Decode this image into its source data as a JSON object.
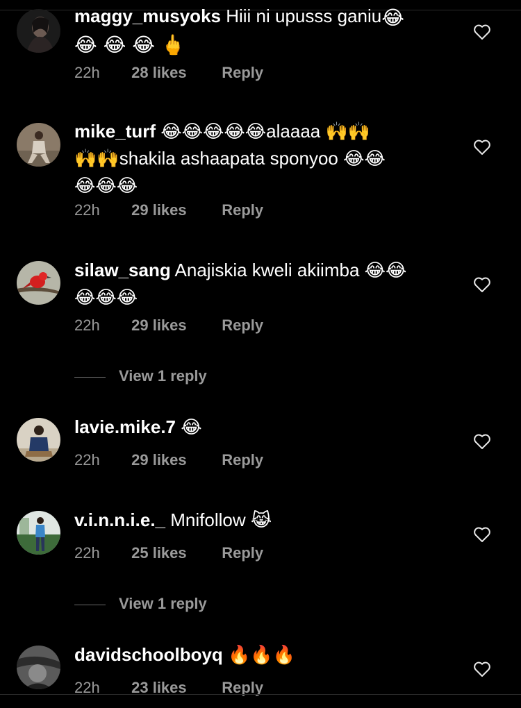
{
  "comments": [
    {
      "username": "maggy_musyoks",
      "text": "Hiii ni upusss ganiu",
      "emojis": "😂 😂 😂 🖕",
      "time": "22h",
      "likes": "28 likes",
      "reply_label": "Reply",
      "avatar_icon": "user-photo-avatar"
    },
    {
      "username": "mike_turf",
      "text_a": "😂😂😂😂😂alaaaa 🙌🙌",
      "text_b": "🙌🙌shakila ashaapata sponyoo 😂😂",
      "text_c": "😂😂😂",
      "time": "22h",
      "likes": "29 likes",
      "reply_label": "Reply",
      "avatar_icon": "user-photo-avatar"
    },
    {
      "username": "silaw_sang",
      "text_a": "Anajiskia kweli akiimba 😂😂",
      "text_b": "😂😂😂",
      "time": "22h",
      "likes": "29 likes",
      "reply_label": "Reply",
      "view_replies": "View 1 reply",
      "avatar_icon": "bird-photo-avatar"
    },
    {
      "username": "lavie.mike.7",
      "text": "😂",
      "time": "22h",
      "likes": "29 likes",
      "reply_label": "Reply",
      "avatar_icon": "user-photo-avatar"
    },
    {
      "username": "v.i.n.n.i.e._",
      "text": "Mnifollow 😹",
      "time": "22h",
      "likes": "25 likes",
      "reply_label": "Reply",
      "view_replies": "View 1 reply",
      "avatar_icon": "user-photo-avatar"
    },
    {
      "username": "davidschoolboyq",
      "text": "🔥🔥🔥",
      "time": "22h",
      "likes": "23 likes",
      "reply_label": "Reply",
      "avatar_icon": "user-photo-avatar"
    }
  ],
  "colors": {
    "background": "#000000",
    "primary_text": "#ffffff",
    "secondary_text": "#9a9a9a"
  },
  "icons": {
    "like": "heart-outline-icon"
  }
}
